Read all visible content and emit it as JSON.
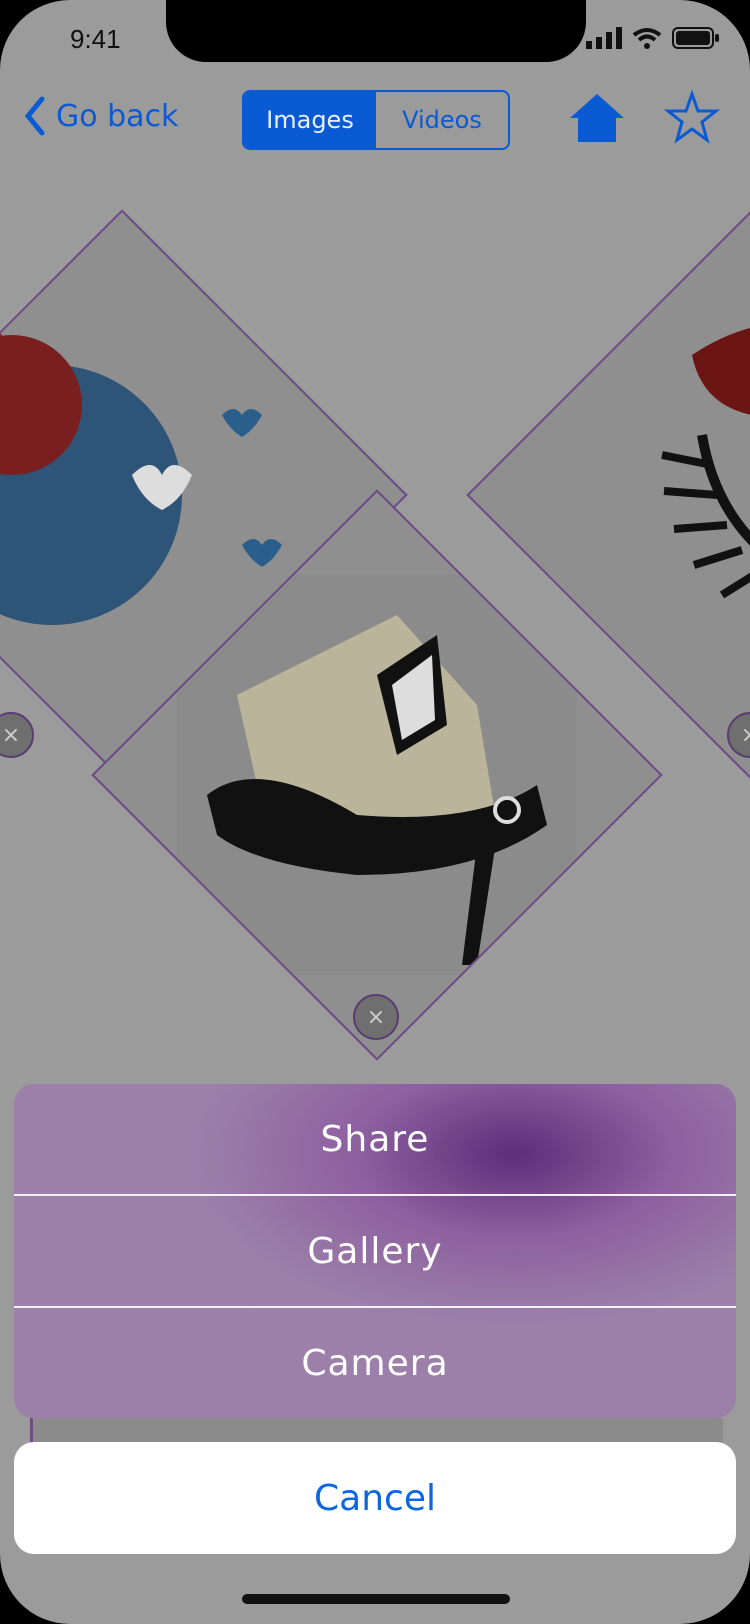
{
  "status": {
    "time": "9:41"
  },
  "nav": {
    "back_label": "Go back",
    "segments": [
      {
        "label": "Images",
        "selected": true
      },
      {
        "label": "Videos",
        "selected": false
      }
    ],
    "home_icon": "home-icon",
    "star_icon": "star-icon"
  },
  "gallery": {
    "items": [
      {
        "name": "hearts-image"
      },
      {
        "name": "shoe-image"
      },
      {
        "name": "lips-eyelashes-image"
      }
    ],
    "delete_symbol": "×"
  },
  "action_sheet": {
    "options": [
      "Share",
      "Gallery",
      "Camera"
    ],
    "cancel_label": "Cancel"
  },
  "colors": {
    "accent": "#0a5bd3",
    "sheet": "#8f6ba3",
    "frame": "#6c4a86"
  }
}
